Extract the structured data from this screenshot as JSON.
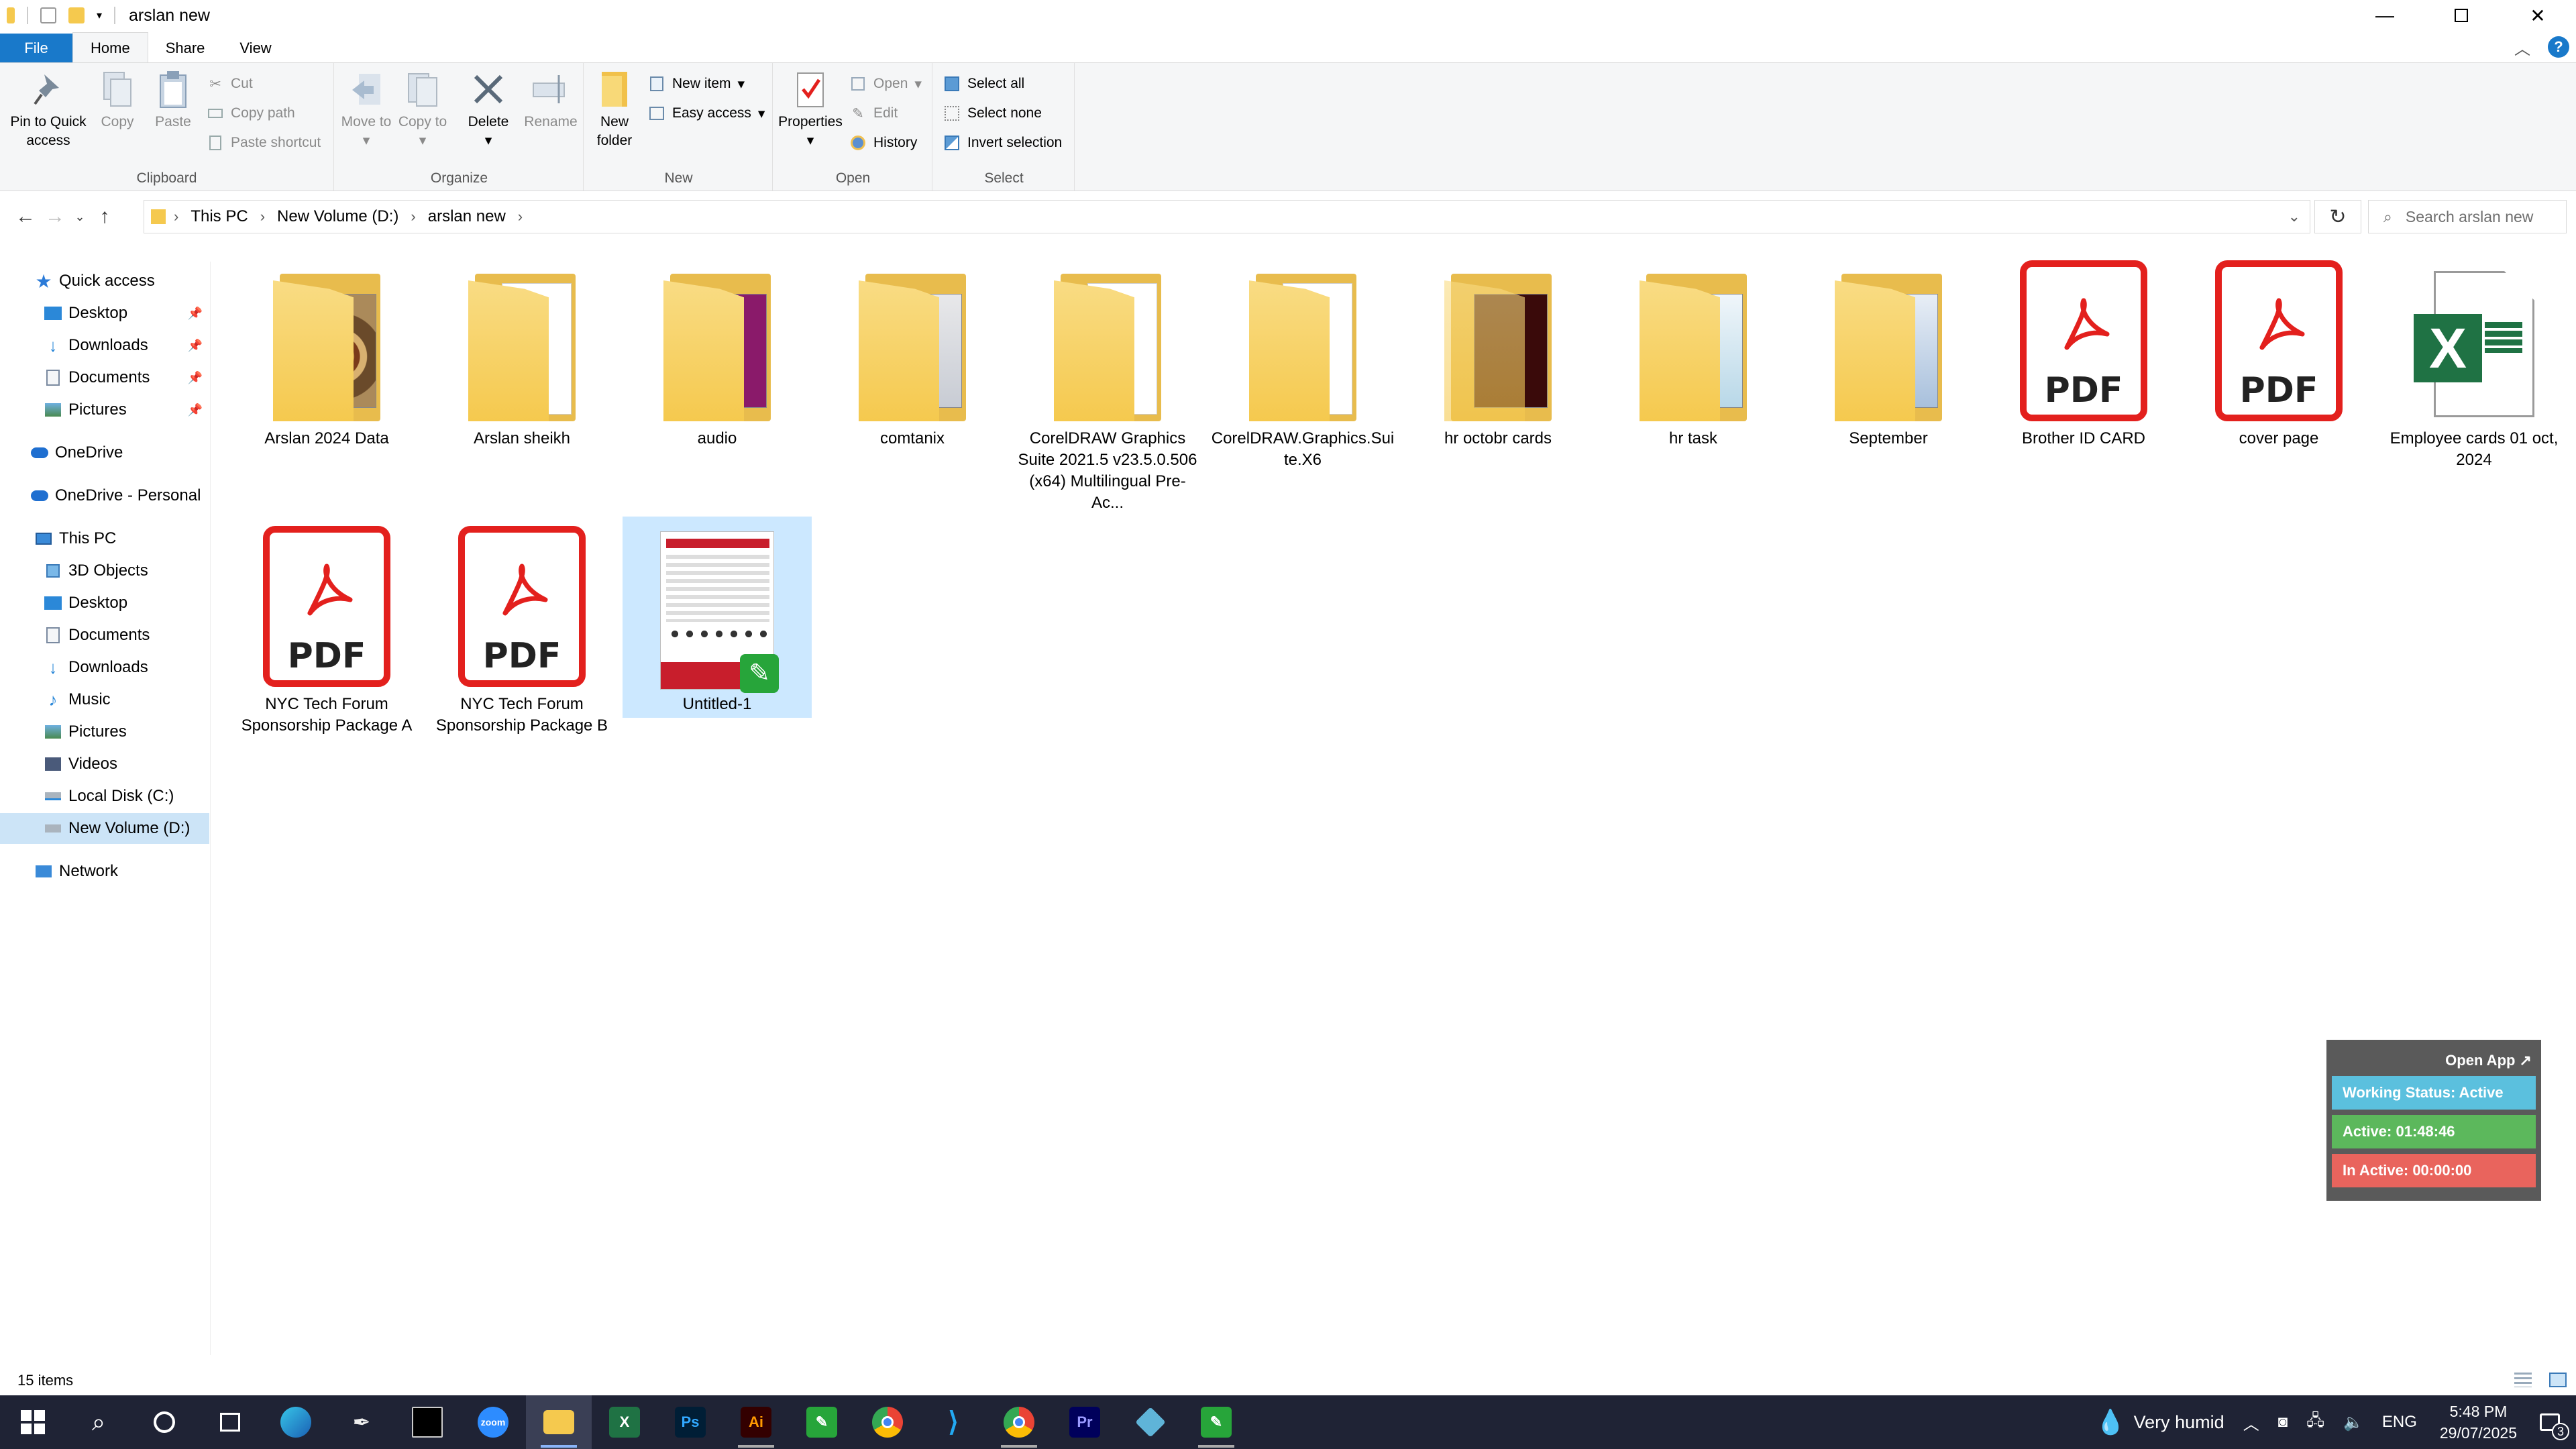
{
  "window": {
    "title": "arslan new"
  },
  "ribbon_tabs": [
    "File",
    "Home",
    "Share",
    "View"
  ],
  "ribbon": {
    "clipboard": {
      "label": "Clipboard",
      "pin": "Pin to Quick access",
      "copy": "Copy",
      "paste": "Paste",
      "cut": "Cut",
      "copy_path": "Copy path",
      "paste_shortcut": "Paste shortcut"
    },
    "organize": {
      "label": "Organize",
      "move_to": "Move to",
      "copy_to": "Copy to",
      "delete": "Delete",
      "rename": "Rename"
    },
    "new": {
      "label": "New",
      "new_folder": "New folder",
      "new_item": "New item",
      "easy_access": "Easy access"
    },
    "open": {
      "label": "Open",
      "properties": "Properties",
      "open": "Open",
      "edit": "Edit",
      "history": "History"
    },
    "select": {
      "label": "Select",
      "select_all": "Select all",
      "select_none": "Select none",
      "invert": "Invert selection"
    }
  },
  "address": {
    "crumbs": [
      "This PC",
      "New Volume (D:)",
      "arslan new"
    ],
    "search_placeholder": "Search arslan new"
  },
  "sidebar": {
    "quick_access": "Quick access",
    "quick_items": [
      "Desktop",
      "Downloads",
      "Documents",
      "Pictures"
    ],
    "onedrive": "OneDrive",
    "onedrive_personal": "OneDrive - Personal",
    "this_pc": "This PC",
    "pc_items": [
      "3D Objects",
      "Desktop",
      "Documents",
      "Downloads",
      "Music",
      "Pictures",
      "Videos",
      "Local Disk (C:)",
      "New Volume (D:)"
    ],
    "network": "Network"
  },
  "files": [
    {
      "name": "Arslan 2024 Data",
      "type": "folder"
    },
    {
      "name": "Arslan sheikh",
      "type": "folder"
    },
    {
      "name": "audio",
      "type": "folder"
    },
    {
      "name": "comtanix",
      "type": "folder"
    },
    {
      "name": "CorelDRAW Graphics Suite 2021.5 v23.5.0.506 (x64) Multilingual Pre-Ac...",
      "type": "folder"
    },
    {
      "name": "CorelDRAW.Graphics.Suite.X6",
      "type": "folder"
    },
    {
      "name": "hr octobr cards",
      "type": "folder"
    },
    {
      "name": "hr task",
      "type": "folder"
    },
    {
      "name": "September",
      "type": "folder"
    },
    {
      "name": "Brother ID CARD",
      "type": "pdf"
    },
    {
      "name": "cover page",
      "type": "pdf"
    },
    {
      "name": "Employee cards 01 oct, 2024",
      "type": "excel"
    },
    {
      "name": "NYC Tech Forum Sponsorship Package A",
      "type": "pdf"
    },
    {
      "name": "NYC Tech Forum Sponsorship Package B",
      "type": "pdf"
    },
    {
      "name": "Untitled-1",
      "type": "cdr"
    }
  ],
  "pdf_label": "PDF",
  "excel_label": "X",
  "status": {
    "count": "15 items"
  },
  "widget": {
    "open_app": "Open App ↗",
    "status": "Working Status: Active",
    "active": "Active: 01:48:46",
    "inactive": "In Active: 00:00:00"
  },
  "tray": {
    "weather": "Very humid",
    "lang": "ENG",
    "time": "5:48 PM",
    "date": "29/07/2025",
    "notif": "3"
  },
  "taskbar_labels": {
    "ps": "Ps",
    "ai": "Ai",
    "pr": "Pr",
    "zoom": "zoom"
  },
  "colors": {
    "accent": "#1979ca",
    "pdf_red": "#e3201d",
    "excel_green": "#1f7244",
    "widget_blue": "#5bc0de",
    "widget_green": "#5cb85c",
    "widget_red": "#d9534f"
  }
}
